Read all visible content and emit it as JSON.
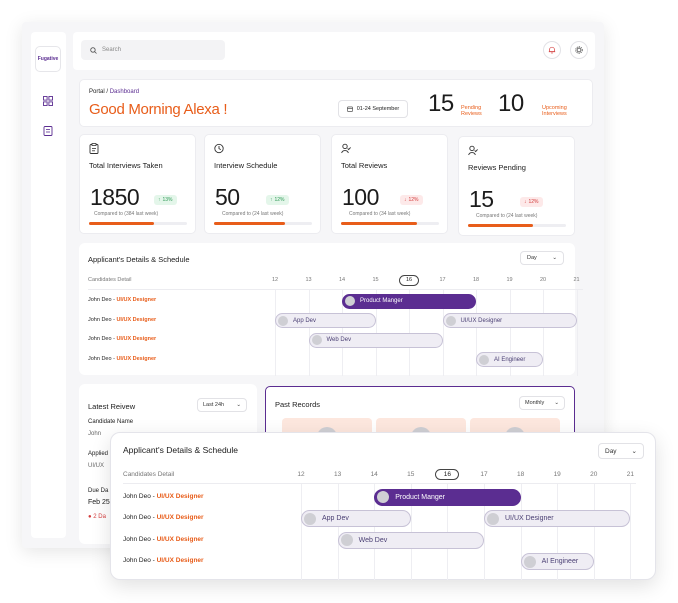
{
  "brand": {
    "logo_text": "Fugative"
  },
  "topbar": {
    "search_placeholder": "Search"
  },
  "icons": {
    "search": "search-icon",
    "bell": "bell-icon",
    "settings": "gear-icon",
    "grid": "grid-icon",
    "doc": "document-icon",
    "calendar": "calendar-icon"
  },
  "colors": {
    "accent": "#e85d1a",
    "brand": "#5b2d91",
    "up": "#2f9a56",
    "down": "#d33c3c"
  },
  "greeting": {
    "crumb_root": "Portal",
    "crumb_sep": "/",
    "crumb_current": "Dashboard",
    "text": "Good Morning Alexa !",
    "date_range": "01-24 September",
    "pending_count": "15",
    "pending_label": "Pending Reviews",
    "upcoming_count": "10",
    "upcoming_label": "Upcoming Interviews"
  },
  "stats": [
    {
      "title": "Total Interviews Taken",
      "value": "1850",
      "change": "13%",
      "dir": "up",
      "compare": "Compared to (384 last week)",
      "progress": 0.66
    },
    {
      "title": "Interview Schedule",
      "value": "50",
      "change": "12%",
      "dir": "up",
      "compare": "Compared to (24 last week)",
      "progress": 0.72
    },
    {
      "title": "Total Reviews",
      "value": "100",
      "change": "12%",
      "dir": "down",
      "compare": "Compared to (34 last week)",
      "progress": 0.78
    },
    {
      "title": "Reviews Pending",
      "value": "15",
      "change": "12%",
      "dir": "down",
      "compare": "Compared to (24 last week)",
      "progress": 0.66
    }
  ],
  "schedule": {
    "title": "Applicant's Details & Schedule",
    "range": "Day",
    "candidates_label": "Candidates Detail",
    "days": [
      "12",
      "13",
      "14",
      "15",
      "16",
      "17",
      "18",
      "19",
      "20",
      "21"
    ],
    "selected_day": "16",
    "rows": [
      {
        "name": "John Deo - ",
        "role": "UI/UX Designer"
      },
      {
        "name": "John Deo - ",
        "role": "UI/UX Designer"
      },
      {
        "name": "John Deo - ",
        "role": "UI/UX Designer"
      },
      {
        "name": "John Deo - ",
        "role": "UI/UX Designer"
      }
    ],
    "events": [
      {
        "label": "Product Manger",
        "row": 0,
        "start": 14,
        "end": 18,
        "style": "dark"
      },
      {
        "label": "App Dev",
        "row": 1,
        "start": 12,
        "end": 15,
        "style": "light"
      },
      {
        "label": "UI/UX Designer",
        "row": 1,
        "start": 17,
        "end": 21,
        "style": "light"
      },
      {
        "label": "Web Dev",
        "row": 2,
        "start": 13,
        "end": 17,
        "style": "light"
      },
      {
        "label": "AI Engineer",
        "row": 3,
        "start": 18,
        "end": 20,
        "style": "light"
      }
    ]
  },
  "latest": {
    "title": "Latest Reivew",
    "range": "Last 24h",
    "candidate_label": "Candidate Name",
    "candidate_value": "John",
    "applied_label": "Applied",
    "applied_value": "UI/UX",
    "due_label": "Due Da",
    "due_value": "Feb 25",
    "status": "2 Da"
  },
  "past": {
    "title": "Past Records",
    "range": "Monthly"
  }
}
